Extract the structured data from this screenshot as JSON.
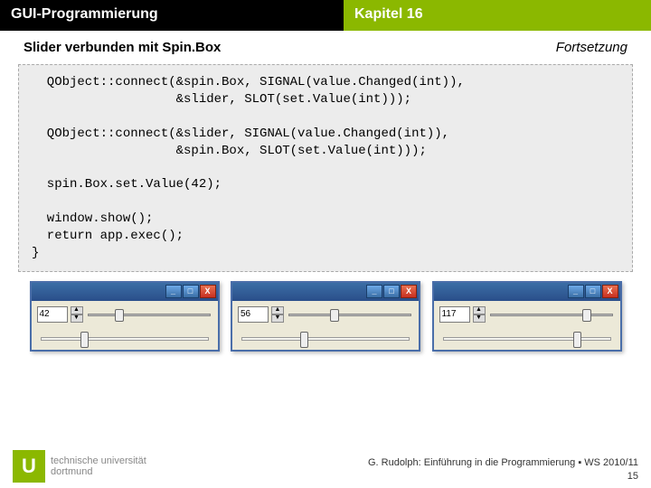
{
  "header": {
    "left": "GUI-Programmierung",
    "right": "Kapitel 16"
  },
  "subheader": {
    "left": "Slider verbunden mit Spin.Box",
    "right": "Fortsetzung"
  },
  "code": "  QObject::connect(&spin.Box, SIGNAL(value.Changed(int)),\n                   &slider, SLOT(set.Value(int)));\n\n  QObject::connect(&slider, SIGNAL(value.Changed(int)),\n                   &spin.Box, SLOT(set.Value(int)));\n\n  spin.Box.set.Value(42);\n\n  window.show();\n  return app.exec();\n}",
  "windows": [
    {
      "spin_value": "42",
      "thumb_pct": 25,
      "bottom_thumb_pct": 26
    },
    {
      "spin_value": "56",
      "thumb_pct": 38,
      "bottom_thumb_pct": 38
    },
    {
      "spin_value": "117",
      "thumb_pct": 85,
      "bottom_thumb_pct": 85
    }
  ],
  "titlebar": {
    "min": "_",
    "max": "□",
    "close": "X"
  },
  "spin": {
    "up": "▲",
    "down": "▼"
  },
  "footer": {
    "logo_char": "U",
    "uni_line1": "technische universität",
    "uni_line2": "dortmund",
    "credit": "G. Rudolph: Einführung in die Programmierung ▪ WS 2010/11",
    "page": "15"
  }
}
